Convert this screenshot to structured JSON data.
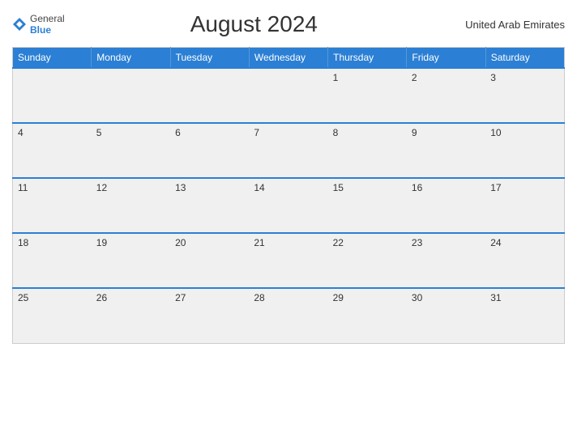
{
  "header": {
    "logo_general": "General",
    "logo_blue": "Blue",
    "title": "August 2024",
    "country": "United Arab Emirates"
  },
  "weekdays": [
    "Sunday",
    "Monday",
    "Tuesday",
    "Wednesday",
    "Thursday",
    "Friday",
    "Saturday"
  ],
  "weeks": [
    [
      "",
      "",
      "",
      "",
      "1",
      "2",
      "3"
    ],
    [
      "4",
      "5",
      "6",
      "7",
      "8",
      "9",
      "10"
    ],
    [
      "11",
      "12",
      "13",
      "14",
      "15",
      "16",
      "17"
    ],
    [
      "18",
      "19",
      "20",
      "21",
      "22",
      "23",
      "24"
    ],
    [
      "25",
      "26",
      "27",
      "28",
      "29",
      "30",
      "31"
    ]
  ]
}
